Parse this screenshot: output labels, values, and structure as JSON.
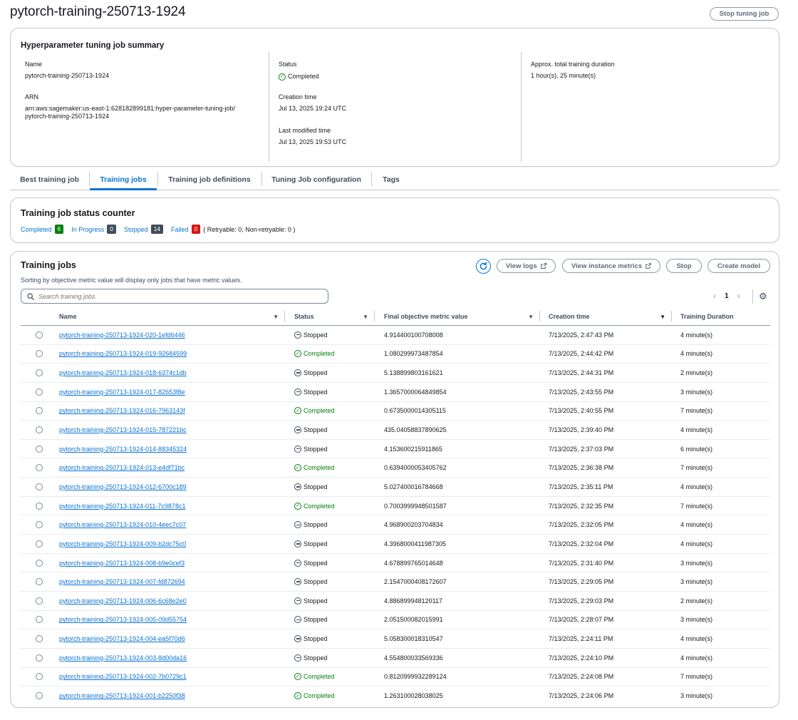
{
  "page": {
    "title": "pytorch-training-250713-1924",
    "stop_button": "Stop tuning job"
  },
  "summary": {
    "title": "Hyperparameter tuning job summary",
    "name_label": "Name",
    "name_value": "pytorch-training-250713-1924",
    "arn_label": "ARN",
    "arn_line1": "arn:aws:sagemaker:us-east-1:628182899181:hyper-parameter-tuning-job/",
    "arn_line2": "pytorch-training-250713-1924",
    "status_label": "Status",
    "status_value": "Completed",
    "creation_label": "Creation time",
    "creation_value": "Jul 13, 2025 19:24 UTC",
    "modified_label": "Last modified time",
    "modified_value": "Jul 13, 2025 19:53 UTC",
    "duration_label": "Approx. total training duration",
    "duration_value": "1 hour(s), 25 minute(s)"
  },
  "tabs": [
    "Best training job",
    "Training jobs",
    "Training job definitions",
    "Tuning Job configuration",
    "Tags"
  ],
  "active_tab": "Training jobs",
  "counter": {
    "title": "Training job status counter",
    "completed_label": "Completed",
    "completed_count": "6",
    "inprogress_label": "In Progress",
    "inprogress_count": "0",
    "stopped_label": "Stopped",
    "stopped_count": "14",
    "failed_label": "Failed",
    "failed_count": "0",
    "failed_note": "( Retryable: 0, Non-retryable: 0 )"
  },
  "jobs": {
    "title": "Training jobs",
    "description": "Sorting by objective metric value will display only jobs that have metric values.",
    "view_logs": "View logs",
    "view_metrics": "View instance metrics",
    "stop": "Stop",
    "create_model": "Create model",
    "search_placeholder": "Search training jobs",
    "page": "1",
    "columns": [
      "Name",
      "Status",
      "Final objective metric value",
      "Creation time",
      "Training Duration"
    ],
    "rows": [
      {
        "name": "pytorch-training-250713-1924-020-1efd6446",
        "status": "Stopped",
        "metric": "4.914400100708008",
        "created": "7/13/2025, 2:47:43 PM",
        "duration": "4 minute(s)"
      },
      {
        "name": "pytorch-training-250713-1924-019-92684599",
        "status": "Completed",
        "metric": "1.080299973487854",
        "created": "7/13/2025, 2:44:42 PM",
        "duration": "4 minute(s)"
      },
      {
        "name": "pytorch-training-250713-1924-018-6374c1db",
        "status": "Stopped",
        "metric": "5.138899803161621",
        "created": "7/13/2025, 2:44:31 PM",
        "duration": "2 minute(s)"
      },
      {
        "name": "pytorch-training-250713-1924-017-82653f8e",
        "status": "Stopped",
        "metric": "1.3657000064849854",
        "created": "7/13/2025, 2:43:55 PM",
        "duration": "3 minute(s)"
      },
      {
        "name": "pytorch-training-250713-1924-016-7963143f",
        "status": "Completed",
        "metric": "0.6735000014305115",
        "created": "7/13/2025, 2:40:55 PM",
        "duration": "7 minute(s)"
      },
      {
        "name": "pytorch-training-250713-1924-015-787221bc",
        "status": "Stopped",
        "metric": "435.04058837890625",
        "created": "7/13/2025, 2:39:40 PM",
        "duration": "4 minute(s)"
      },
      {
        "name": "pytorch-training-250713-1924-014-88345324",
        "status": "Stopped",
        "metric": "4.153600215911865",
        "created": "7/13/2025, 2:37:03 PM",
        "duration": "6 minute(s)"
      },
      {
        "name": "pytorch-training-250713-1924-013-e4df71bc",
        "status": "Completed",
        "metric": "0.6394000053405762",
        "created": "7/13/2025, 2:36:38 PM",
        "duration": "7 minute(s)"
      },
      {
        "name": "pytorch-training-250713-1924-012-6700c189",
        "status": "Stopped",
        "metric": "5.027400016784668",
        "created": "7/13/2025, 2:35:11 PM",
        "duration": "4 minute(s)"
      },
      {
        "name": "pytorch-training-250713-1924-011-7c9878c1",
        "status": "Completed",
        "metric": "0.7003999948501587",
        "created": "7/13/2025, 2:32:35 PM",
        "duration": "7 minute(s)"
      },
      {
        "name": "pytorch-training-250713-1924-010-4eec7c07",
        "status": "Stopped",
        "metric": "4.968900203704834",
        "created": "7/13/2025, 2:32:05 PM",
        "duration": "4 minute(s)"
      },
      {
        "name": "pytorch-training-250713-1924-009-b2dc75c0",
        "status": "Stopped",
        "metric": "4.3968000411987305",
        "created": "7/13/2025, 2:32:04 PM",
        "duration": "4 minute(s)"
      },
      {
        "name": "pytorch-training-250713-1924-008-b9e0cef3",
        "status": "Stopped",
        "metric": "4.678899765014648",
        "created": "7/13/2025, 2:31:40 PM",
        "duration": "3 minute(s)"
      },
      {
        "name": "pytorch-training-250713-1924-007-fd872694",
        "status": "Stopped",
        "metric": "2.1547000408172607",
        "created": "7/13/2025, 2:29:05 PM",
        "duration": "3 minute(s)"
      },
      {
        "name": "pytorch-training-250713-1924-006-6c68e2e0",
        "status": "Stopped",
        "metric": "4.886899948120117",
        "created": "7/13/2025, 2:29:03 PM",
        "duration": "2 minute(s)"
      },
      {
        "name": "pytorch-training-250713-1924-005-09d55754",
        "status": "Stopped",
        "metric": "2.051500082015991",
        "created": "7/13/2025, 2:28:07 PM",
        "duration": "3 minute(s)"
      },
      {
        "name": "pytorch-training-250713-1924-004-ea5f70d6",
        "status": "Stopped",
        "metric": "5.058300018310547",
        "created": "7/13/2025, 2:24:11 PM",
        "duration": "4 minute(s)"
      },
      {
        "name": "pytorch-training-250713-1924-003-8d00da16",
        "status": "Stopped",
        "metric": "4.554800033569336",
        "created": "7/13/2025, 2:24:10 PM",
        "duration": "4 minute(s)"
      },
      {
        "name": "pytorch-training-250713-1924-002-7b0729c1",
        "status": "Completed",
        "metric": "0.8120999932289124",
        "created": "7/13/2025, 2:24:08 PM",
        "duration": "7 minute(s)"
      },
      {
        "name": "pytorch-training-250713-1924-001-b2250f38",
        "status": "Completed",
        "metric": "1.263100028038025",
        "created": "7/13/2025, 2:24:06 PM",
        "duration": "3 minute(s)"
      }
    ]
  },
  "icons": {
    "refresh": "refresh-icon",
    "external": "external-link-icon",
    "search": "search-icon",
    "settings": "gear-icon",
    "completed": "check-circle-icon",
    "stopped": "stop-circle-icon"
  },
  "colors": {
    "accent": "#0972d3",
    "success": "#037f0c",
    "error": "#d91515",
    "neutral_badge": "#414d5c"
  }
}
